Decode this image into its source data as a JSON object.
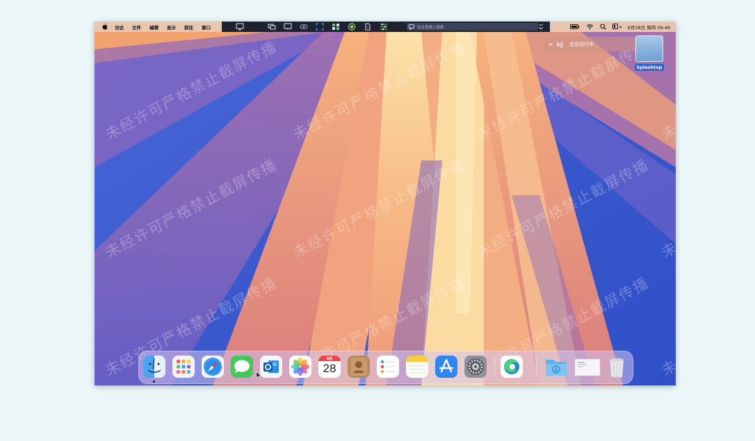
{
  "menubar": {
    "menus": [
      "访达",
      "文件",
      "编辑",
      "显示",
      "前往",
      "窗口"
    ],
    "search_placeholder": "在这里输入搜索",
    "clock": "8月28日 周四 09:49"
  },
  "remote_toolbar": {
    "icons": [
      "screen-icon",
      "monitor-share-icon",
      "display-icon",
      "eye-icon",
      "fullscreen-icon",
      "grid-icon",
      "record-icon",
      "file-icon",
      "settings-sliders-icon"
    ]
  },
  "status_icons": [
    "battery-icon",
    "wifi-icon",
    "search-icon",
    "control-center-icon"
  ],
  "notification": {
    "session_text": "会话进行中"
  },
  "desktop": {
    "item_label": "Splashtop"
  },
  "watermark": {
    "text": "未经许可严格禁止截屏传播"
  },
  "dock": {
    "apps": [
      "Finder",
      "Launchpad",
      "Safari",
      "Messages",
      "Outlook",
      "Photos",
      "Calendar",
      "Contacts",
      "Reminders",
      "Notes",
      "App Store",
      "System Settings",
      "Edge",
      "Downloads",
      "Documents",
      "Trash"
    ],
    "calendar_month": "8月",
    "calendar_day": "28"
  },
  "colors": {
    "toolbar_bg": "#1c2230",
    "menubar_bg": "#f6ceac",
    "accent_blue": "#2f64d6",
    "wallpaper_blue": "#3f5ccf",
    "wallpaper_orange": "#f2a06a"
  }
}
